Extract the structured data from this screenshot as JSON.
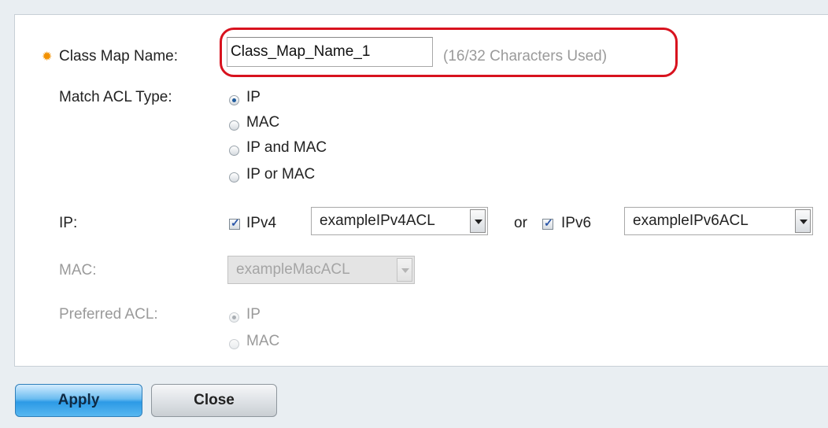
{
  "form": {
    "class_map_name": {
      "label": "Class Map Name:",
      "value": "Class_Map_Name_1",
      "hint": "(16/32 Characters Used)"
    },
    "match_acl_type": {
      "label": "Match ACL Type:",
      "options": [
        "IP",
        "MAC",
        "IP and MAC",
        "IP or MAC"
      ],
      "selected": "IP"
    },
    "ip": {
      "label": "IP:",
      "ipv4_label": "IPv4",
      "ipv4_checked": true,
      "ipv4_select": "exampleIPv4ACL",
      "or_label": "or",
      "ipv6_label": "IPv6",
      "ipv6_checked": true,
      "ipv6_select": "exampleIPv6ACL"
    },
    "mac": {
      "label": "MAC:",
      "select": "exampleMacACL",
      "disabled": true
    },
    "preferred_acl": {
      "label": "Preferred ACL:",
      "options": [
        "IP",
        "MAC"
      ],
      "selected": "IP",
      "disabled": true
    }
  },
  "buttons": {
    "apply": "Apply",
    "close": "Close"
  },
  "colors": {
    "required_icon": "#f29100",
    "highlight": "#d8121e",
    "apply_button": "#2c9ae6"
  }
}
